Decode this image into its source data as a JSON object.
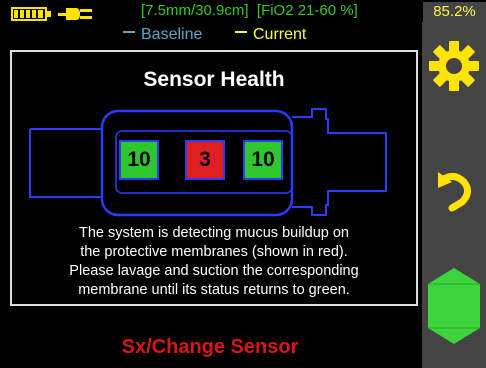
{
  "status_bar": {
    "range_text": "[7.5mm/30.9cm]  [FiO2 21-60 %]",
    "percent": "85.2%",
    "battery_icon": "battery-full-icon",
    "power_icon": "power-plug-icon"
  },
  "legend": {
    "baseline_label": "Baseline",
    "current_label": "Current",
    "baseline_color": "#5aa8c9",
    "current_color": "#ffff40"
  },
  "panel": {
    "title": "Sensor Health",
    "membranes": [
      {
        "value": "10",
        "status": "ok",
        "color": "#2ec82e"
      },
      {
        "value": "3",
        "status": "fault",
        "color": "#e02020"
      },
      {
        "value": "10",
        "status": "ok",
        "color": "#2ec82e"
      }
    ],
    "description_lines": [
      "The system is detecting mucus buildup on",
      "the protective membranes (shown in red).",
      "Please lavage and suction the corresponding",
      "membrane until its status returns to green."
    ]
  },
  "footer": {
    "action_label": "Sx/Change Sensor",
    "action_color": "#d81616"
  },
  "sidebar": {
    "settings_icon": "gear-icon",
    "back_icon": "undo-arrow-icon",
    "nav_icon": "hexagon-button-icon",
    "accent_color": "#ffe400",
    "nav_color": "#3ed43e"
  }
}
